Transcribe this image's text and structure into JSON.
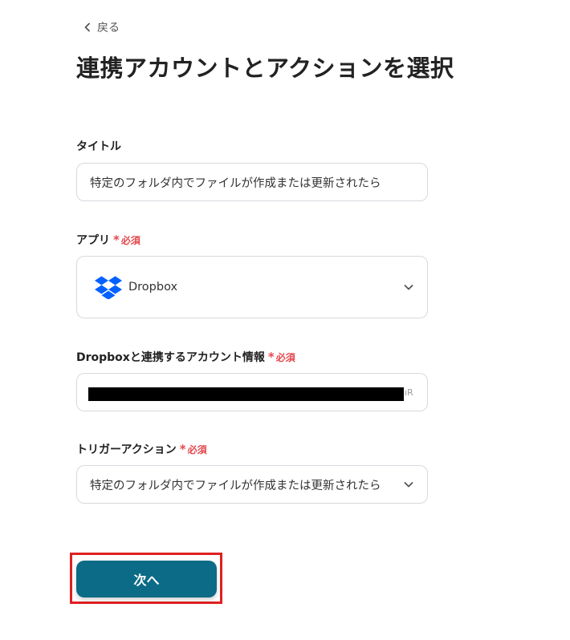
{
  "header": {
    "back_label": "戻る",
    "title": "連携アカウントとアクションを選択"
  },
  "form": {
    "title_field": {
      "label": "タイトル",
      "value": "特定のフォルダ内でファイルが作成または更新されたら"
    },
    "app_field": {
      "label": "アプリ",
      "required_label": "必須",
      "value": "Dropbox",
      "icon": "dropbox-icon",
      "brand_color": "#0061FE"
    },
    "account_field": {
      "label": "Dropboxと連携するアカウント情報",
      "required_label": "必須",
      "tail_text": "ıR"
    },
    "trigger_field": {
      "label": "トリガーアクション",
      "required_label": "必須",
      "value": "特定のフォルダ内でファイルが作成または更新されたら"
    }
  },
  "actions": {
    "next_label": "次へ",
    "next_color": "#0C6B86",
    "highlight_color": "#E02020"
  },
  "colors": {
    "required": "#E5484D"
  }
}
